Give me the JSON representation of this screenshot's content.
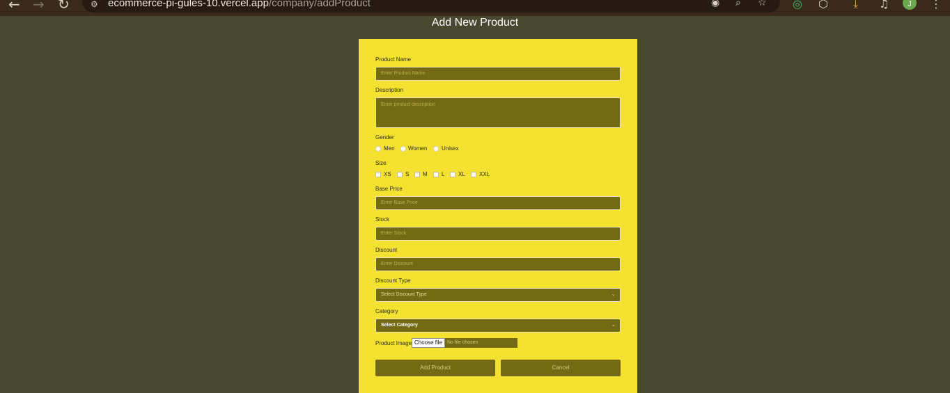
{
  "browser": {
    "url_host": "ecommerce-pi-gules-10.vercel.app",
    "url_path": "/company/addProduct",
    "avatar_letter": "J"
  },
  "page": {
    "title": "Add New Product"
  },
  "form": {
    "product_name": {
      "label": "Product Name",
      "placeholder": "Enter Product Name"
    },
    "description": {
      "label": "Description",
      "placeholder": "Enter product description"
    },
    "gender": {
      "label": "Gender",
      "options": [
        "Men",
        "Women",
        "Unisex"
      ]
    },
    "size": {
      "label": "Size",
      "options": [
        "XS",
        "S",
        "M",
        "L",
        "XL",
        "XXL"
      ]
    },
    "base_price": {
      "label": "Base Price",
      "placeholder": "Enter Base Price"
    },
    "stock": {
      "label": "Stock",
      "placeholder": "Enter Stock"
    },
    "discount": {
      "label": "Discount",
      "placeholder": "Enter Discount"
    },
    "discount_type": {
      "label": "Discount Type",
      "selected": "Select Discount Type"
    },
    "category": {
      "label": "Category",
      "selected": "Select Category"
    },
    "product_image": {
      "label": "Product Image",
      "button": "Choose file",
      "status": "No file chosen"
    },
    "submit_label": "Add Product",
    "cancel_label": "Cancel"
  }
}
